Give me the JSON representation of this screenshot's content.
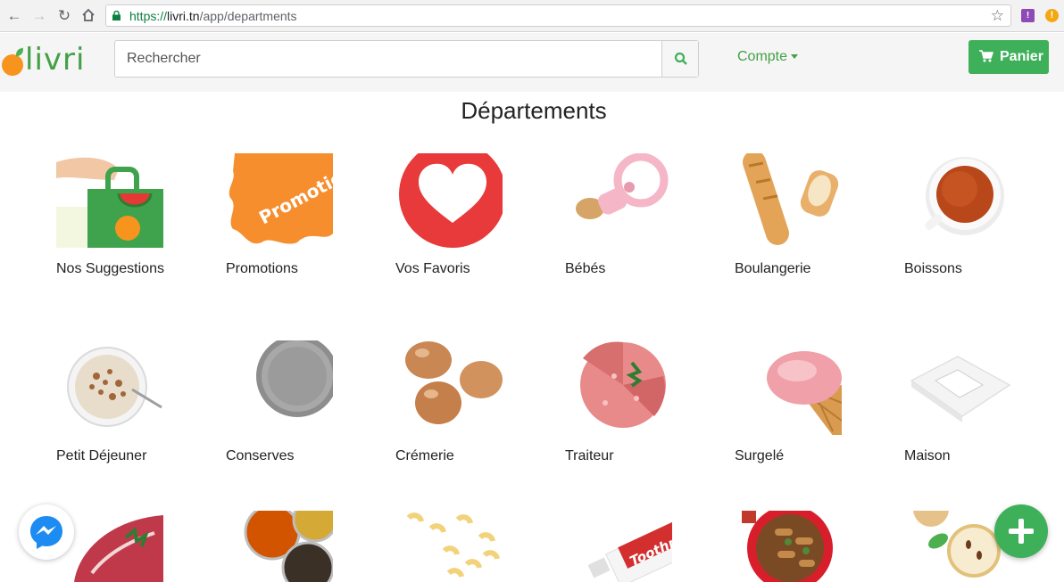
{
  "browser": {
    "url_scheme": "https://",
    "url_host": "livri.tn",
    "url_path": "/app/departments"
  },
  "header": {
    "logo_text": "livri",
    "search_placeholder": "Rechercher",
    "account_label": "Compte",
    "cart_label": "Panier"
  },
  "page_title": "Départements",
  "departments": [
    {
      "label": "Nos Suggestions",
      "icon": "suggestions-bag"
    },
    {
      "label": "Promotions",
      "icon": "promotion-splash",
      "image_text": "Promotion"
    },
    {
      "label": "Vos Favoris",
      "icon": "heart"
    },
    {
      "label": "Bébés",
      "icon": "pacifier"
    },
    {
      "label": "Boulangerie",
      "icon": "baguette"
    },
    {
      "label": "Boissons",
      "icon": "tea-cup"
    },
    {
      "label": "Petit Déjeuner",
      "icon": "cereal-bowl"
    },
    {
      "label": "Conserves",
      "icon": "tin-can"
    },
    {
      "label": "Crémerie",
      "icon": "eggs"
    },
    {
      "label": "Traiteur",
      "icon": "salami"
    },
    {
      "label": "Surgelé",
      "icon": "ice-cream"
    },
    {
      "label": "Maison",
      "icon": "tissue-box"
    },
    {
      "label": "",
      "icon": "steak"
    },
    {
      "label": "",
      "icon": "spices"
    },
    {
      "label": "",
      "icon": "pasta"
    },
    {
      "label": "",
      "icon": "toothpaste",
      "image_text": "Toothp"
    },
    {
      "label": "",
      "icon": "pet-food"
    },
    {
      "label": "",
      "icon": "apple"
    }
  ],
  "colors": {
    "brand_green": "#43a047",
    "button_green": "#3fb05a",
    "logo_orange": "#f7941d"
  }
}
